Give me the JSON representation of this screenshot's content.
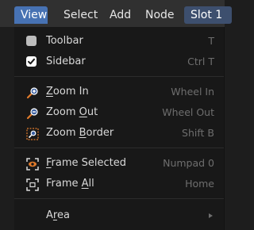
{
  "menubar": {
    "items": [
      {
        "label": "View"
      },
      {
        "label": "Select"
      },
      {
        "label": "Add"
      },
      {
        "label": "Node"
      },
      {
        "label": "Slot 1"
      }
    ]
  },
  "dropdown": {
    "toolbar": {
      "label": "Toolbar",
      "shortcut": "T",
      "checked": false
    },
    "sidebar": {
      "label": "Sidebar",
      "shortcut": "Ctrl T",
      "checked": true
    },
    "zoom_in": {
      "label_u": "Z",
      "label_rest": "oom In",
      "shortcut": "Wheel In",
      "icon": "zoom-in-icon"
    },
    "zoom_out": {
      "label_pre": "Zoom ",
      "label_u": "O",
      "label_rest": "ut",
      "shortcut": "Wheel Out",
      "icon": "zoom-out-icon"
    },
    "zoom_border": {
      "label_pre": "Zoom ",
      "label_u": "B",
      "label_rest": "order",
      "shortcut": "Shift B",
      "icon": "zoom-border-icon"
    },
    "frame_selected": {
      "label_u": "F",
      "label_rest": "rame Selected",
      "shortcut": "Numpad 0",
      "icon": "frame-selected-icon"
    },
    "frame_all": {
      "label_pre": "Frame ",
      "label_u": "A",
      "label_rest": "ll",
      "shortcut": "Home",
      "icon": "frame-all-icon"
    },
    "area": {
      "label_pre": "A",
      "label_u": "r",
      "label_rest": "ea",
      "icon": "submenu-arrow-icon"
    }
  },
  "colors": {
    "accent": "#4772b3",
    "menu_bg": "#181818",
    "header_bg": "#303030",
    "shortcut_text": "#6e6e6e",
    "zoom_icon_orange": "#e07a2b"
  }
}
